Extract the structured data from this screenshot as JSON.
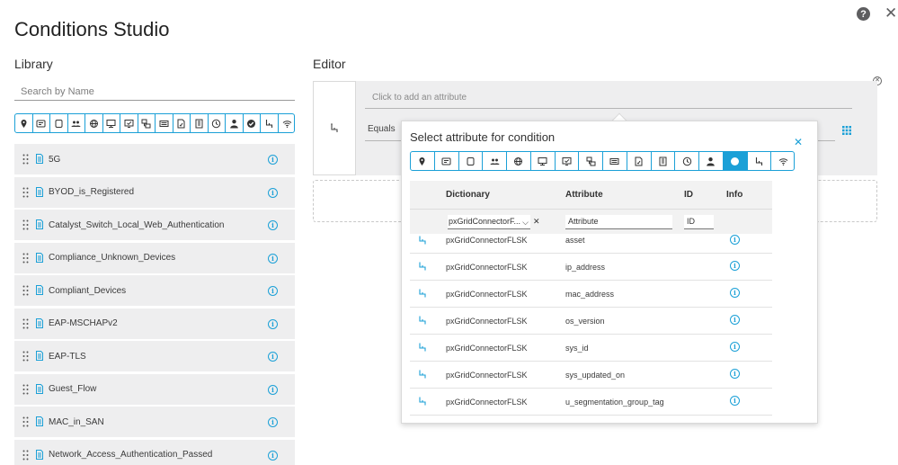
{
  "title": "Conditions Studio",
  "library": {
    "title": "Library",
    "search_placeholder": "Search by Name",
    "icons": [
      "location-icon",
      "endpoint-profile-icon",
      "device-icon",
      "identity-group-icon",
      "network-icon",
      "network-device-icon",
      "posture-icon",
      "network-device-group-icon",
      "network-condition-icon",
      "certificate-icon",
      "building-icon",
      "time-icon",
      "user-icon",
      "compliance-icon",
      "pxgrid-icon",
      "wireless-icon"
    ],
    "items": [
      {
        "label": "5G"
      },
      {
        "label": "BYOD_is_Registered"
      },
      {
        "label": "Catalyst_Switch_Local_Web_Authentication"
      },
      {
        "label": "Compliance_Unknown_Devices"
      },
      {
        "label": "Compliant_Devices"
      },
      {
        "label": "EAP-MSCHAPv2"
      },
      {
        "label": "EAP-TLS"
      },
      {
        "label": "Guest_Flow"
      },
      {
        "label": "MAC_in_SAN"
      },
      {
        "label": "Network_Access_Authentication_Passed"
      }
    ]
  },
  "editor": {
    "title": "Editor",
    "attribute_placeholder": "Click to add an attribute",
    "operator": "Equals"
  },
  "dialog": {
    "title": "Select attribute for condition",
    "icons": [
      "location-icon",
      "endpoint-profile-icon",
      "device-icon",
      "identity-group-icon",
      "network-icon",
      "network-device-icon",
      "posture-icon",
      "network-device-group-icon",
      "network-condition-icon",
      "certificate-icon",
      "building-icon",
      "time-icon",
      "user-icon",
      "compliance-icon",
      "pxgrid-icon",
      "wireless-icon"
    ],
    "active_icon_index": 13,
    "columns": {
      "dictionary": "Dictionary",
      "attribute": "Attribute",
      "id": "ID",
      "info": "Info"
    },
    "filters": {
      "dictionary": "pxGridConnectorF...",
      "attribute_placeholder": "Attribute",
      "id_placeholder": "ID"
    },
    "rows": [
      {
        "dictionary": "pxGridConnectorFLSK",
        "attribute": "asset"
      },
      {
        "dictionary": "pxGridConnectorFLSK",
        "attribute": "ip_address"
      },
      {
        "dictionary": "pxGridConnectorFLSK",
        "attribute": "mac_address"
      },
      {
        "dictionary": "pxGridConnectorFLSK",
        "attribute": "os_version"
      },
      {
        "dictionary": "pxGridConnectorFLSK",
        "attribute": "sys_id"
      },
      {
        "dictionary": "pxGridConnectorFLSK",
        "attribute": "sys_updated_on"
      },
      {
        "dictionary": "pxGridConnectorFLSK",
        "attribute": "u_segmentation_group_tag"
      }
    ]
  },
  "colors": {
    "accent": "#1ba0d7",
    "item_bg": "#eeeeef",
    "text": "#3a3a3a"
  }
}
